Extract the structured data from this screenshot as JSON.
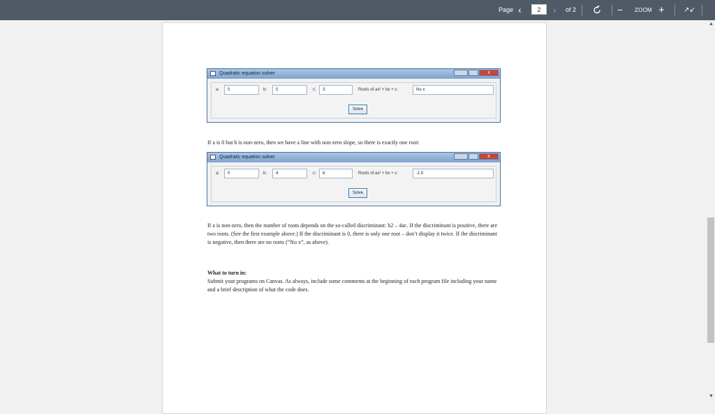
{
  "toolbar": {
    "page_label": "Page",
    "prev_icon": "‹",
    "current_page": "2",
    "next_icon": "›",
    "of_label": "of 2",
    "rotate_icon": "rotate-icon",
    "zoom_out": "−",
    "zoom_label": "ZOOM",
    "zoom_in": "+",
    "collapse_icon": "↗↙"
  },
  "windows": [
    {
      "title": "Quadratic equation solver",
      "close_icon": "x",
      "a_label": "a:",
      "a_value": "0",
      "b_label": "b:",
      "b_value": "0",
      "c_label": "c:",
      "c_value": "3",
      "roots_label": "Roots of ax² + bx + c:",
      "roots_value": "No x",
      "solve_label": "Solve"
    },
    {
      "title": "Quadratic equation solver",
      "close_icon": "x",
      "a_label": "a:",
      "a_value": "0",
      "b_label": "b:",
      "b_value": "4",
      "c_label": "c:",
      "c_value": "6",
      "roots_label": "Roots of ax² + bx + c:",
      "roots_value": "-1.5",
      "solve_label": "Solve"
    }
  ],
  "text": {
    "line_case": "If a is 0 but b is non-zero, then we have a line with non-zero slope, so there is exactly one root:",
    "discriminant_para": "If a is non-zero, then the number of roots depends on the so-called discriminant: b2 – 4ac. If the discriminant is positive, there are two roots. (See the first example above.) If the discriminant is 0, there is only one root – don’t display it twice. If the discriminant is negative, then there are no roots (“No x”, as above).",
    "turn_in_heading": "What to turn in:",
    "turn_in_body": "Submit your programs on Canvas. As always, include some comments at the beginning of each program file including your name and a brief description of what the code does."
  },
  "colors": {
    "toolbar": "#505a67",
    "title_bar": "#8fb0d6",
    "close_button": "#c9443a"
  }
}
